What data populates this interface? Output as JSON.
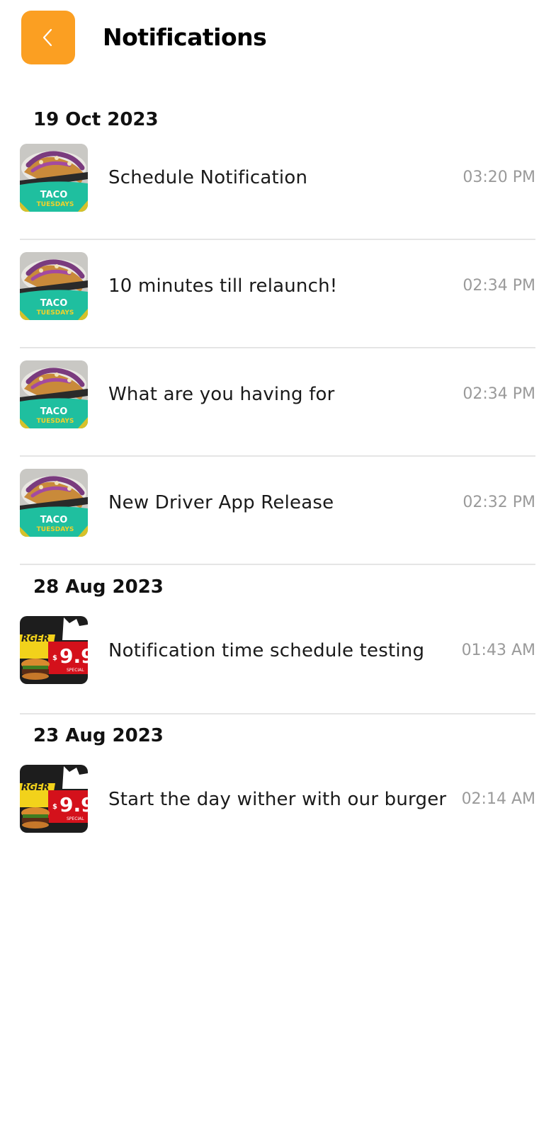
{
  "header": {
    "title": "Notifications",
    "back_icon": "chevron-left-icon",
    "accent_color": "#fb9f22"
  },
  "groups": [
    {
      "date": "19 Oct 2023",
      "items": [
        {
          "title": "Schedule Notification",
          "time": "03:20 PM",
          "image": "taco-tuesdays-thumbnail"
        },
        {
          "title": "10 minutes till relaunch!",
          "time": "02:34 PM",
          "image": "taco-tuesdays-thumbnail"
        },
        {
          "title": "What are you having for",
          "time": "02:34 PM",
          "image": "taco-tuesdays-thumbnail"
        },
        {
          "title": "New Driver App Release",
          "time": "02:32 PM",
          "image": "taco-tuesdays-thumbnail"
        }
      ]
    },
    {
      "date": "28 Aug 2023",
      "items": [
        {
          "title": "Notification time schedule testing",
          "time": "01:43 AM",
          "image": "burger-special-thumbnail"
        }
      ]
    },
    {
      "date": "23 Aug 2023",
      "items": [
        {
          "title": "Start the day wither with our burger",
          "time": "02:14 AM",
          "image": "burger-special-thumbnail"
        }
      ]
    }
  ],
  "thumbnails": {
    "taco": {
      "line1": "TACO",
      "line2": "TUESDAYS"
    },
    "burger": {
      "word": "RGER",
      "price": "9.9",
      "dollar": "$",
      "tag": "SPECIAL"
    }
  }
}
